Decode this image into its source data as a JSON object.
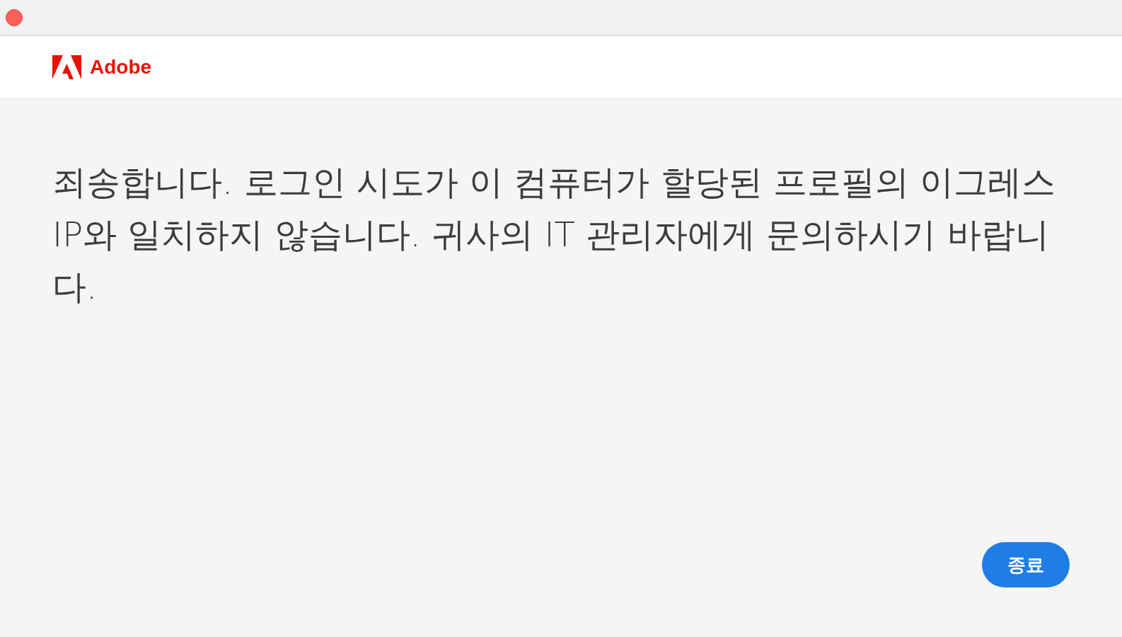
{
  "header": {
    "brand": "Adobe"
  },
  "message": "죄송합니다. 로그인 시도가 이 컴퓨터가 할당된 프로필의 이그레스 IP와 일치하지 않습니다. 귀사의 IT 관리자에게 문의하시기 바랍니다.",
  "buttons": [
    {
      "label": "종료"
    }
  ]
}
